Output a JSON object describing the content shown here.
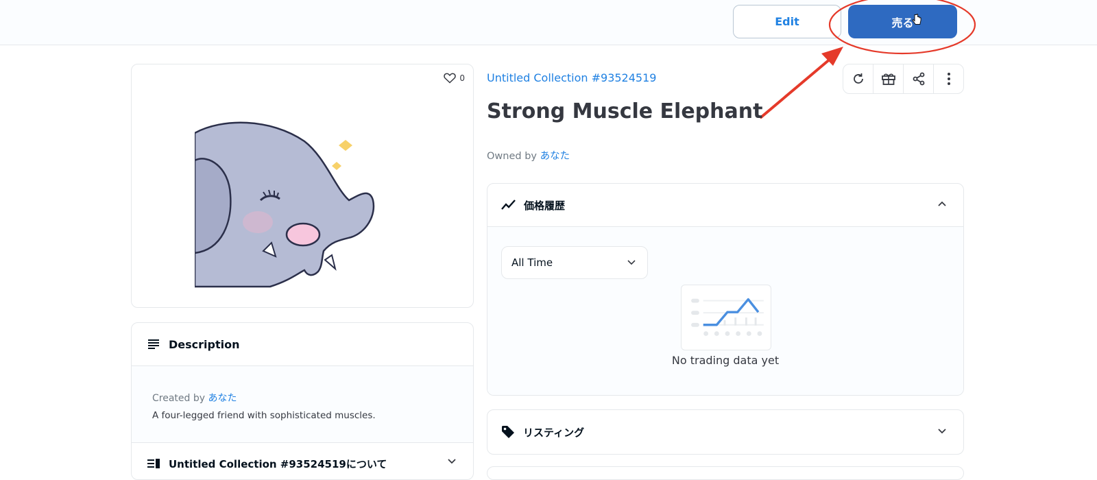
{
  "header": {
    "edit_label": "Edit",
    "sell_label": "売る"
  },
  "item": {
    "favorite_count": "0",
    "collection_name": "Untitled Collection #93524519",
    "title": "Strong Muscle Elephant",
    "owned_by_prefix": "Owned by",
    "owner": "あなた"
  },
  "description": {
    "heading": "Description",
    "created_by_prefix": "Created by",
    "creator": "あなた",
    "text": "A four-legged friend with sophisticated muscles."
  },
  "about": {
    "heading": "Untitled Collection #93524519について"
  },
  "price_history": {
    "heading": "価格履歴",
    "period_selected": "All Time",
    "empty_text": "No trading data yet"
  },
  "listing": {
    "heading": "リスティング"
  },
  "icons": {
    "favorite": "heart-icon",
    "refresh": "refresh-icon",
    "gift": "gift-icon",
    "share": "share-icon",
    "more": "more-vertical-icon",
    "description": "lines-icon",
    "about": "list-icon",
    "price": "trend-icon",
    "listing": "tag-icon"
  },
  "colors": {
    "accent_blue": "#2081e2",
    "sell_button": "#2e6ac1",
    "annotation_red": "#e53a2a"
  }
}
